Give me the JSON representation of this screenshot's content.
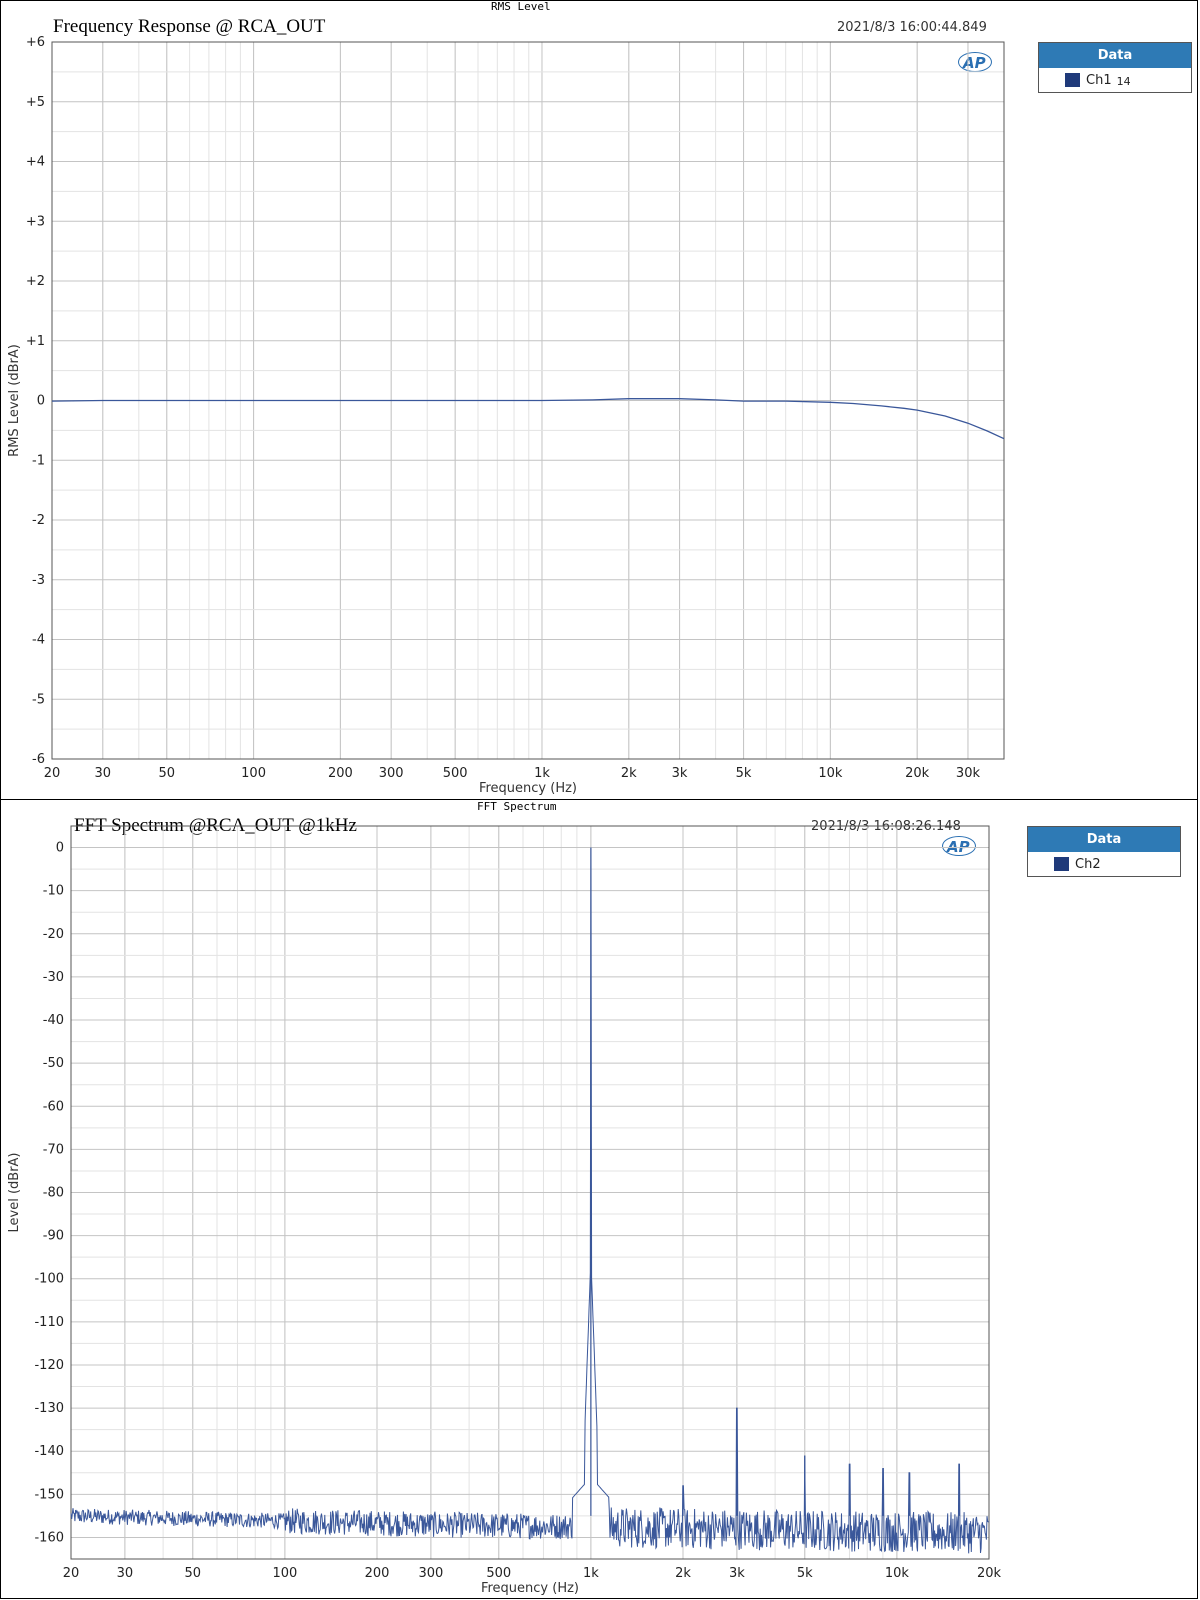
{
  "top": {
    "header_label": "RMS Level",
    "title": "Frequency Response @ RCA_OUT",
    "timestamp": "2021/8/3 16:00:44.849",
    "legend": {
      "title": "Data",
      "items": [
        {
          "name": "Ch1",
          "sub": "14",
          "color": "#1f3a7a"
        }
      ]
    }
  },
  "bottom": {
    "header_label": "FFT Spectrum",
    "title": "FFT Spectrum @RCA_OUT @1kHz",
    "timestamp": "2021/8/3 16:08:26.148",
    "legend": {
      "title": "Data",
      "items": [
        {
          "name": "Ch2",
          "color": "#1f3a7a"
        }
      ]
    }
  },
  "logo_text": "AP",
  "colors": {
    "trace": "#3a579a",
    "legend_header": "#2e7ab5",
    "grid": "#c8c8c8"
  },
  "chart_data": [
    {
      "type": "line",
      "xlabel": "Frequency (Hz)",
      "ylabel": "RMS Level (dBrA)",
      "xscale": "log",
      "xlim": [
        20,
        40000
      ],
      "ylim": [
        -6,
        6
      ],
      "xticks": [
        20,
        30,
        50,
        100,
        200,
        300,
        500,
        1000,
        2000,
        3000,
        5000,
        10000,
        20000,
        30000
      ],
      "xticklabels": [
        "20",
        "30",
        "50",
        "100",
        "200",
        "300",
        "500",
        "1k",
        "2k",
        "3k",
        "5k",
        "10k",
        "20k",
        "30k"
      ],
      "yticks": [
        6,
        5,
        4,
        3,
        2,
        1,
        0,
        -1,
        -2,
        -3,
        -4,
        -5,
        -6
      ],
      "yticklabels": [
        "+6",
        "+5",
        "+4",
        "+3",
        "+2",
        "+1",
        "0",
        "-1",
        "-2",
        "-3",
        "-4",
        "-5",
        "-6"
      ],
      "grid": true,
      "legend": "top-right",
      "series": [
        {
          "name": "Ch1",
          "color": "#3a579a",
          "x": [
            20,
            30,
            50,
            100,
            200,
            500,
            1000,
            1500,
            2000,
            3000,
            4000,
            5000,
            7000,
            10000,
            12000,
            15000,
            18000,
            20000,
            25000,
            30000,
            35000,
            40000
          ],
          "y": [
            -0.01,
            0.0,
            0.0,
            0.0,
            0.0,
            0.0,
            0.0,
            0.01,
            0.03,
            0.03,
            0.01,
            -0.01,
            -0.01,
            -0.03,
            -0.05,
            -0.09,
            -0.13,
            -0.16,
            -0.26,
            -0.38,
            -0.51,
            -0.64
          ]
        }
      ]
    },
    {
      "type": "line",
      "xlabel": "Frequency (Hz)",
      "ylabel": "Level (dBrA)",
      "xscale": "log",
      "xlim": [
        20,
        20000
      ],
      "ylim": [
        -165,
        5
      ],
      "xticks": [
        20,
        30,
        50,
        100,
        200,
        300,
        500,
        1000,
        2000,
        3000,
        5000,
        10000,
        20000
      ],
      "xticklabels": [
        "20",
        "30",
        "50",
        "100",
        "200",
        "300",
        "500",
        "1k",
        "2k",
        "3k",
        "5k",
        "10k",
        "20k"
      ],
      "yticks": [
        0,
        -10,
        -20,
        -30,
        -40,
        -50,
        -60,
        -70,
        -80,
        -90,
        -100,
        -110,
        -120,
        -130,
        -140,
        -150,
        -160
      ],
      "yticklabels": [
        "0",
        "-10",
        "-20",
        "-30",
        "-40",
        "-50",
        "-60",
        "-70",
        "-80",
        "-90",
        "-100",
        "-110",
        "-120",
        "-130",
        "-140",
        "-150",
        "-160"
      ],
      "grid": true,
      "legend": "top-right",
      "noise_floor": {
        "low_freq_level": -155,
        "mid_freq_level": -157,
        "high_freq_level": -159,
        "variation": 3
      },
      "series": [
        {
          "name": "Ch2",
          "color": "#3a579a",
          "peaks": [
            {
              "x": 1000,
              "y": 0
            },
            {
              "x": 2000,
              "y": -148
            },
            {
              "x": 3000,
              "y": -130
            },
            {
              "x": 5000,
              "y": -141
            },
            {
              "x": 7000,
              "y": -143
            },
            {
              "x": 9000,
              "y": -144
            },
            {
              "x": 11000,
              "y": -145
            },
            {
              "x": 16000,
              "y": -143
            }
          ]
        }
      ]
    }
  ]
}
